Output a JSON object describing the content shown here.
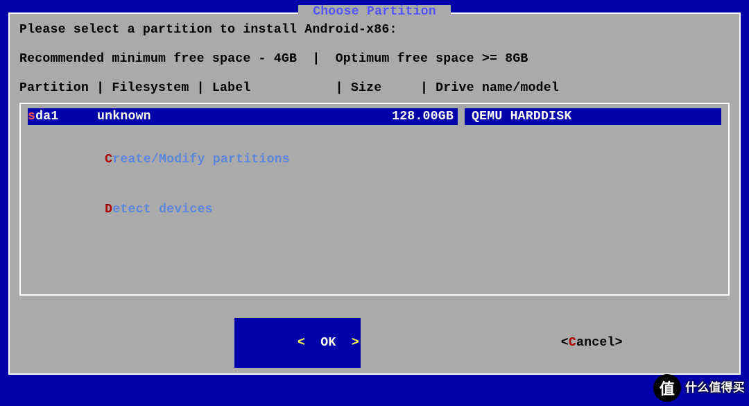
{
  "dialog": {
    "title": " Choose Partition ",
    "prompt": "Please select a partition to install Android-x86:",
    "hint": "Recommended minimum free space - 4GB  |  Optimum free space >= 8GB",
    "columns": "Partition | Filesystem | Label           | Size     | Drive name/model"
  },
  "partitions": [
    {
      "hot": "s",
      "name_rest": "da1",
      "filesystem": "unknown",
      "size": "128.00GB",
      "drive": "QEMU HARDDISK",
      "selected": true
    }
  ],
  "options": [
    {
      "hot": "C",
      "rest": "reate/Modify partitions"
    },
    {
      "hot": "D",
      "rest": "etect devices"
    }
  ],
  "buttons": {
    "ok_open": "<",
    "ok_label": "  OK  ",
    "ok_close": ">",
    "cancel_open": "<",
    "cancel_hot": "C",
    "cancel_rest": "ancel",
    "cancel_close": ">"
  },
  "watermark": {
    "badge": "值",
    "line1": "什么值得买",
    "line2": ""
  }
}
